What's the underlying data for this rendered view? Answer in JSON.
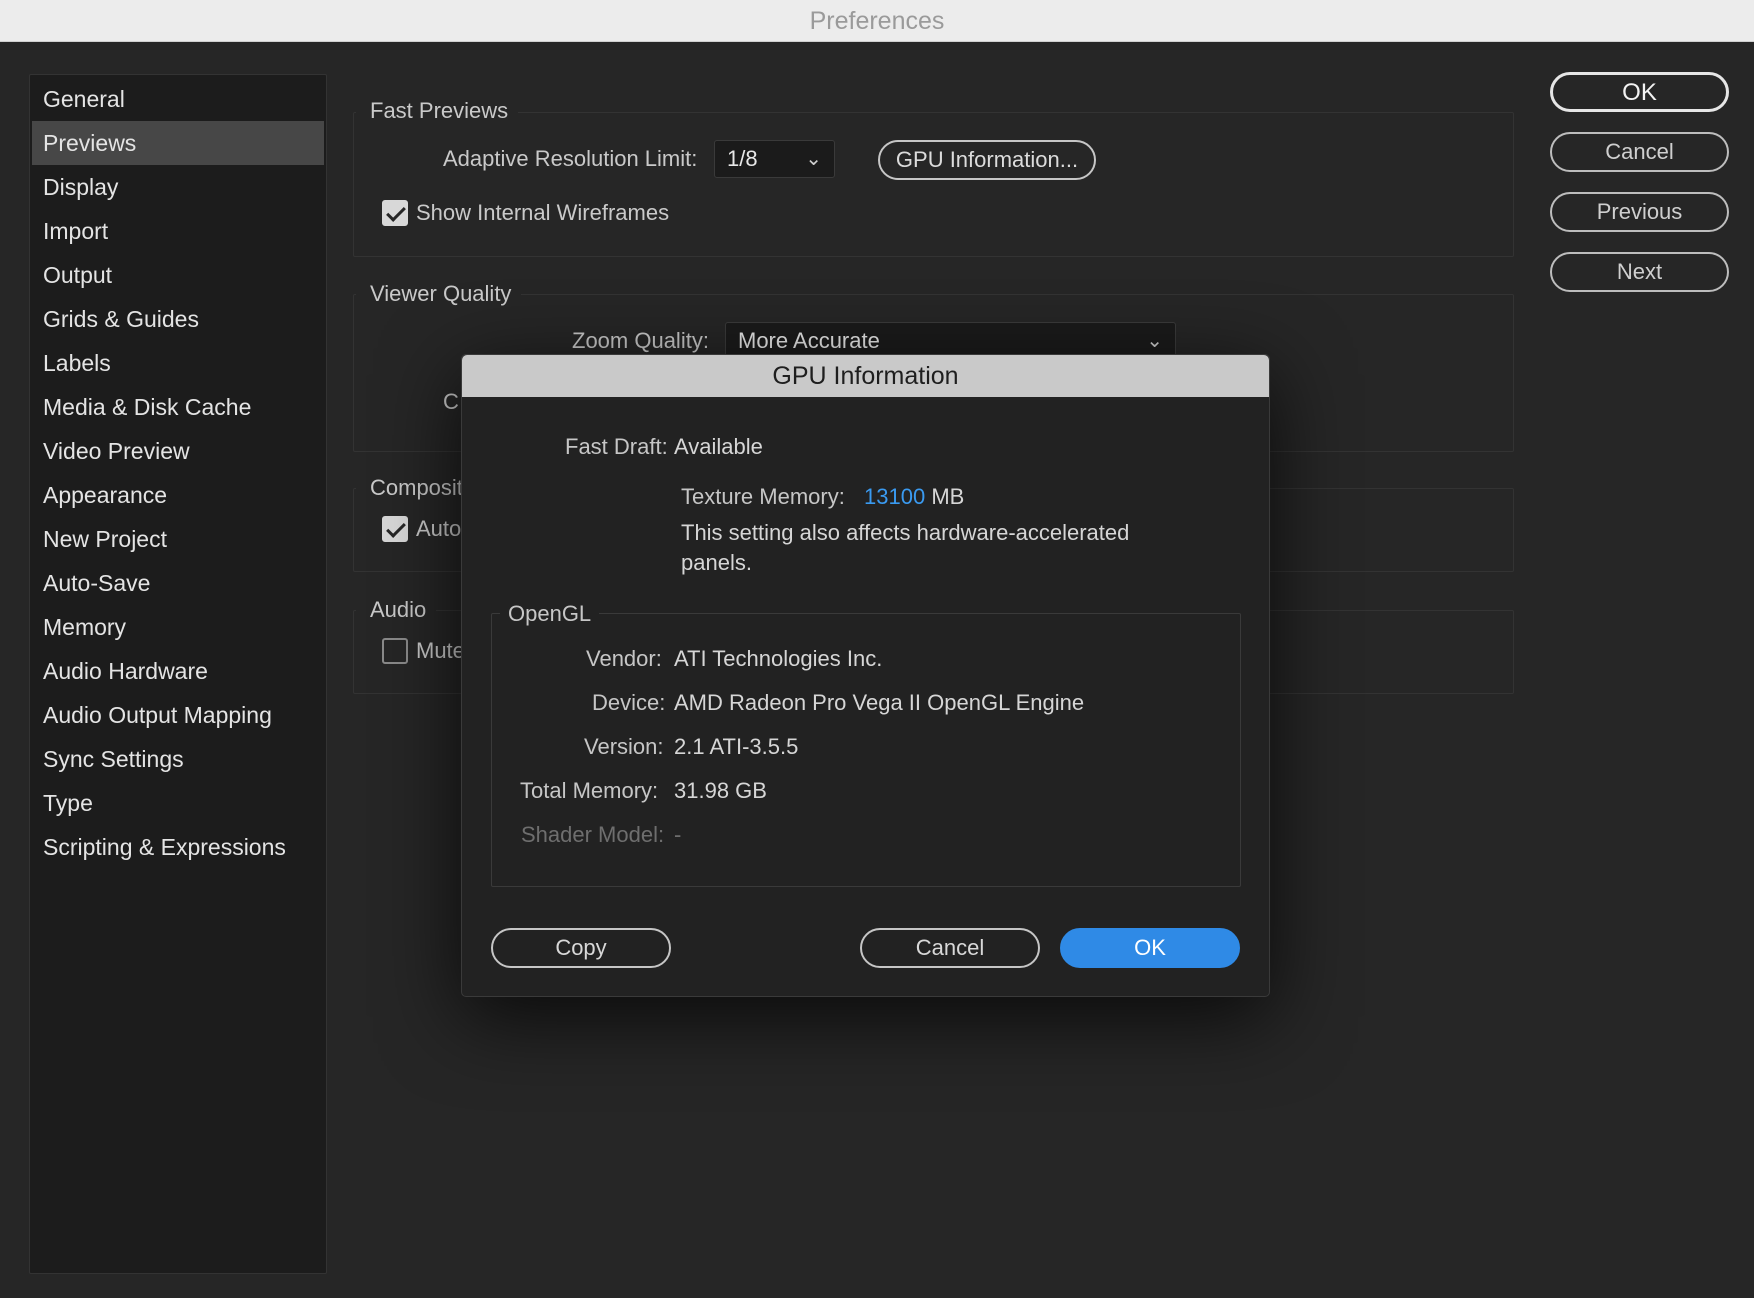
{
  "window": {
    "title": "Preferences"
  },
  "sidebar": {
    "selected_index": 1,
    "items": [
      {
        "label": "General"
      },
      {
        "label": "Previews"
      },
      {
        "label": "Display"
      },
      {
        "label": "Import"
      },
      {
        "label": "Output"
      },
      {
        "label": "Grids & Guides"
      },
      {
        "label": "Labels"
      },
      {
        "label": "Media & Disk Cache"
      },
      {
        "label": "Video Preview"
      },
      {
        "label": "Appearance"
      },
      {
        "label": "New Project"
      },
      {
        "label": "Auto-Save"
      },
      {
        "label": "Memory"
      },
      {
        "label": "Audio Hardware"
      },
      {
        "label": "Audio Output Mapping"
      },
      {
        "label": "Sync Settings"
      },
      {
        "label": "Type"
      },
      {
        "label": "Scripting & Expressions"
      }
    ]
  },
  "fast_previews": {
    "title": "Fast Previews",
    "adaptive_label": "Adaptive Resolution Limit:",
    "adaptive_value": "1/8",
    "gpu_button": "GPU Information...",
    "wireframes_label": "Show Internal Wireframes",
    "wireframes_checked": true
  },
  "viewer_quality": {
    "title": "Viewer Quality",
    "zoom_label": "Zoom Quality:",
    "zoom_value": "More Accurate",
    "partial_label": "C"
  },
  "compositing": {
    "title": "Composit",
    "checkbox_label": "Auto",
    "checked": true
  },
  "audio": {
    "title": "Audio",
    "checkbox_label": "Mute",
    "checked": false
  },
  "side_buttons": {
    "ok": "OK",
    "cancel": "Cancel",
    "previous": "Previous",
    "next": "Next"
  },
  "gpu_dialog": {
    "title": "GPU Information",
    "fast_draft_label": "Fast Draft:",
    "fast_draft_value": "Available",
    "texture_memory_label": "Texture Memory:",
    "texture_memory_value": "13100",
    "texture_memory_unit": "MB",
    "note": "This setting also affects hardware-accelerated panels.",
    "opengl": {
      "title": "OpenGL",
      "vendor_label": "Vendor:",
      "vendor_value": "ATI Technologies Inc.",
      "device_label": "Device:",
      "device_value": "AMD Radeon Pro Vega II OpenGL Engine",
      "version_label": "Version:",
      "version_value": "2.1 ATI-3.5.5",
      "total_memory_label": "Total Memory:",
      "total_memory_value": "31.98 GB",
      "shader_label": "Shader Model:",
      "shader_value": "-"
    },
    "buttons": {
      "copy": "Copy",
      "cancel": "Cancel",
      "ok": "OK"
    }
  },
  "colors": {
    "accent_blue": "#2f8ae6",
    "link_blue": "#3a9af0",
    "background": "#262626"
  }
}
